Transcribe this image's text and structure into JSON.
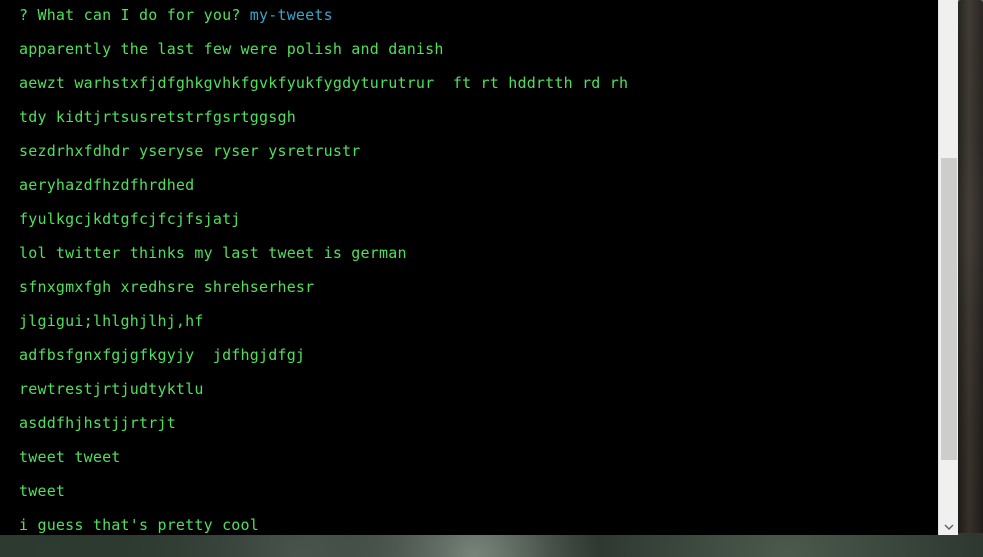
{
  "terminal": {
    "prompt": {
      "marker": "?",
      "question": "What can I do for you?",
      "answer": "my-tweets"
    },
    "lines": [
      "apparently the last few were polish and danish",
      "aewzt warhstxfjdfghkgvhkfgvkfyukfygdyturutrur  ft rt hddrtth rd rh",
      "tdy kidtjrtsusretstrfgsrtggsgh",
      "sezdrhxfdhdr yseryse ryser ysretrustr",
      "aeryhazdfhzdfhrdhed",
      "fyulkgcjkdtgfcjfcjfsjatj",
      "lol twitter thinks my last tweet is german",
      "sfnxgmxfgh xredhsre shrehserhesr",
      "jlgigui;lhlghjlhj,hf",
      "adfbsfgnxfgjgfkgyjy  jdfhgjdfgj",
      "rewtrestjrtjudtyktlu",
      "asddfhjhstjjrtrjt",
      "tweet tweet",
      "tweet",
      "i guess that's pretty cool"
    ],
    "colors": {
      "text": "#4ee05a",
      "answer": "#3aa4c8",
      "background": "#000000"
    }
  },
  "scrollbar": {
    "down_icon": "chevron-down-icon",
    "position_fraction": 0.73
  }
}
